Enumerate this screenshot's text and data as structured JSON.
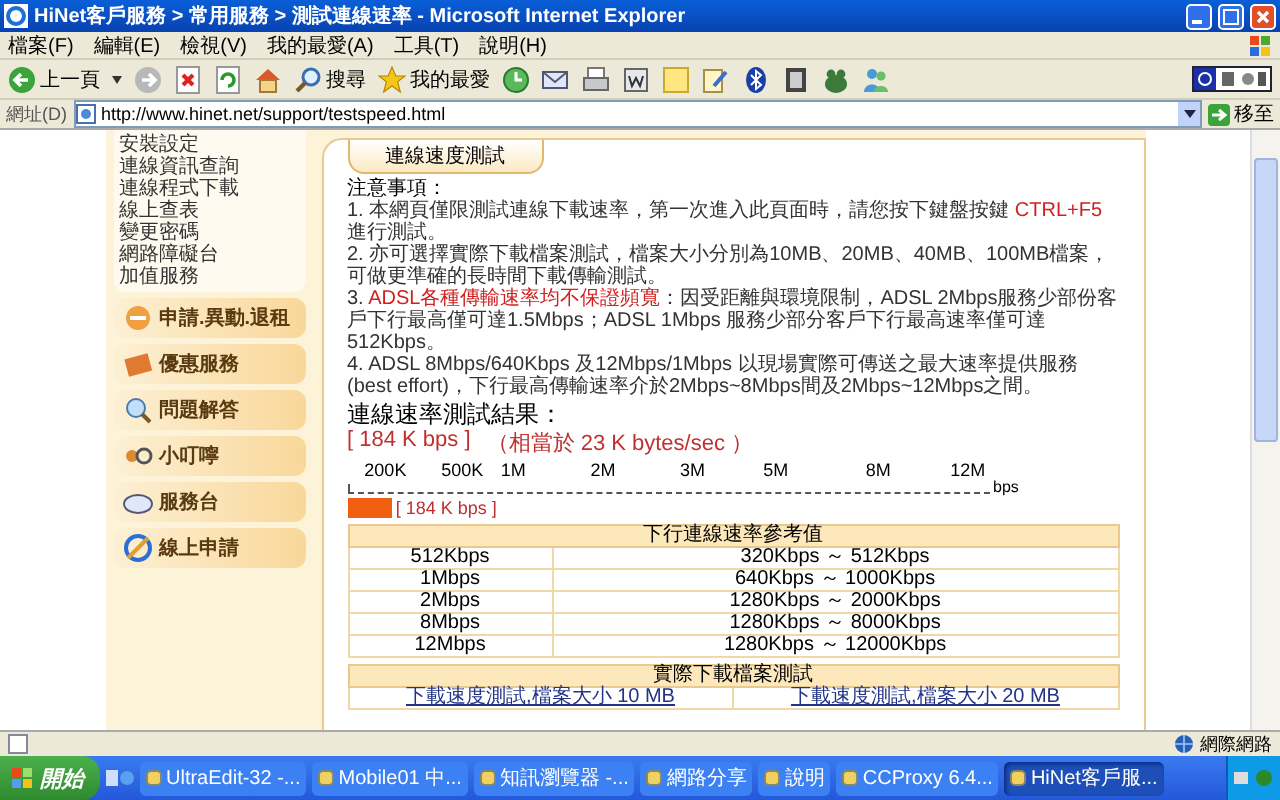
{
  "window": {
    "title": "HiNet客戶服務 > 常用服務 > 測試連線速率 - Microsoft Internet Explorer"
  },
  "menu": [
    "檔案(F)",
    "編輯(E)",
    "檢視(V)",
    "我的最愛(A)",
    "工具(T)",
    "說明(H)"
  ],
  "toolbar": {
    "back": "上一頁",
    "search": "搜尋",
    "favorites": "我的最愛"
  },
  "address": {
    "label": "網址(D)",
    "value": "http://www.hinet.net/support/testspeed.html",
    "go": "移至"
  },
  "sidebar": {
    "links": [
      "安裝設定",
      "連線資訊查詢",
      "連線程式下載",
      "線上查表",
      "變更密碼",
      "網路障礙台",
      "加值服務"
    ],
    "buttons": [
      "申請.異動.退租",
      "優惠服務",
      "問題解答",
      "小叮嚀",
      "服務台",
      "線上申請"
    ]
  },
  "content": {
    "tab": "連線速度測試",
    "notes_title": "注意事項：",
    "notes": [
      [
        {
          "text": "1. 本網頁僅限測試連線下載速率，第一次進入此頁面時，請您按下鍵盤按鍵 ",
          "emphasis": false
        },
        {
          "text": "CTRL+F5",
          "emphasis": true
        },
        {
          "text": " 進行測試。",
          "emphasis": false
        }
      ],
      [
        {
          "text": "2. 亦可選擇實際下載檔案測試，檔案大小分別為10MB、20MB、40MB、100MB檔案，可做更準確的長時間下載傳輸測試。",
          "emphasis": false
        }
      ],
      [
        {
          "text": "3. ",
          "emphasis": false
        },
        {
          "text": "ADSL各種傳輸速率均不保證頻寬",
          "emphasis": true
        },
        {
          "text": "：因受距離與環境限制，ADSL 2Mbps服務少部份客戶下行最高僅可達1.5Mbps；ADSL 1Mbps 服務少部分客戶下行最高速率僅可達512Kbps。",
          "emphasis": false
        }
      ],
      [
        {
          "text": "4. ADSL 8Mbps/640Kbps 及12Mbps/1Mbps 以現場實際可傳送之最大速率提供服務(best effort)，下行最高傳輸速率介於2Mbps~8Mbps間及2Mbps~12Mbps之間。",
          "emphasis": false
        }
      ]
    ],
    "result": {
      "title": "連線速率測試結果：",
      "reading": "[ 184 K bps ]",
      "equivalent": "（相當於 23 K bytes/sec ）",
      "scale": [
        "200K",
        "500K",
        "1M",
        "2M",
        "3M",
        "5M",
        "8M",
        "12M"
      ],
      "unit": "bps",
      "level": 0.07,
      "bar_label": "[ 184 K bps ]"
    },
    "reference_table": {
      "title": "下行連線速率參考值",
      "rows": [
        [
          "512Kbps",
          "320Kbps ～ 512Kbps"
        ],
        [
          "1Mbps",
          "640Kbps ～ 1000Kbps"
        ],
        [
          "2Mbps",
          "1280Kbps ～ 2000Kbps"
        ],
        [
          "8Mbps",
          "1280Kbps ～ 8000Kbps"
        ],
        [
          "12Mbps",
          "1280Kbps ～ 12000Kbps"
        ]
      ]
    },
    "download_table": {
      "title": "實際下載檔案測試",
      "links": [
        "下載速度測試,檔案大小 10 MB",
        "下載速度測試,檔案大小 20 MB"
      ]
    }
  },
  "status_bar": {
    "zone": "網際網路"
  },
  "taskbar": {
    "start": "開始",
    "tasks": [
      {
        "label": "UltraEdit-32 -...",
        "selected": false
      },
      {
        "label": "Mobile01 中...",
        "selected": false
      },
      {
        "label": "知訊瀏覽器 -...",
        "selected": false
      },
      {
        "label": "網路分享",
        "selected": false
      },
      {
        "label": "說明",
        "selected": false
      },
      {
        "label": "CCProxy 6.4...",
        "selected": false
      },
      {
        "label": "HiNet客戶服...",
        "selected": true
      }
    ]
  }
}
